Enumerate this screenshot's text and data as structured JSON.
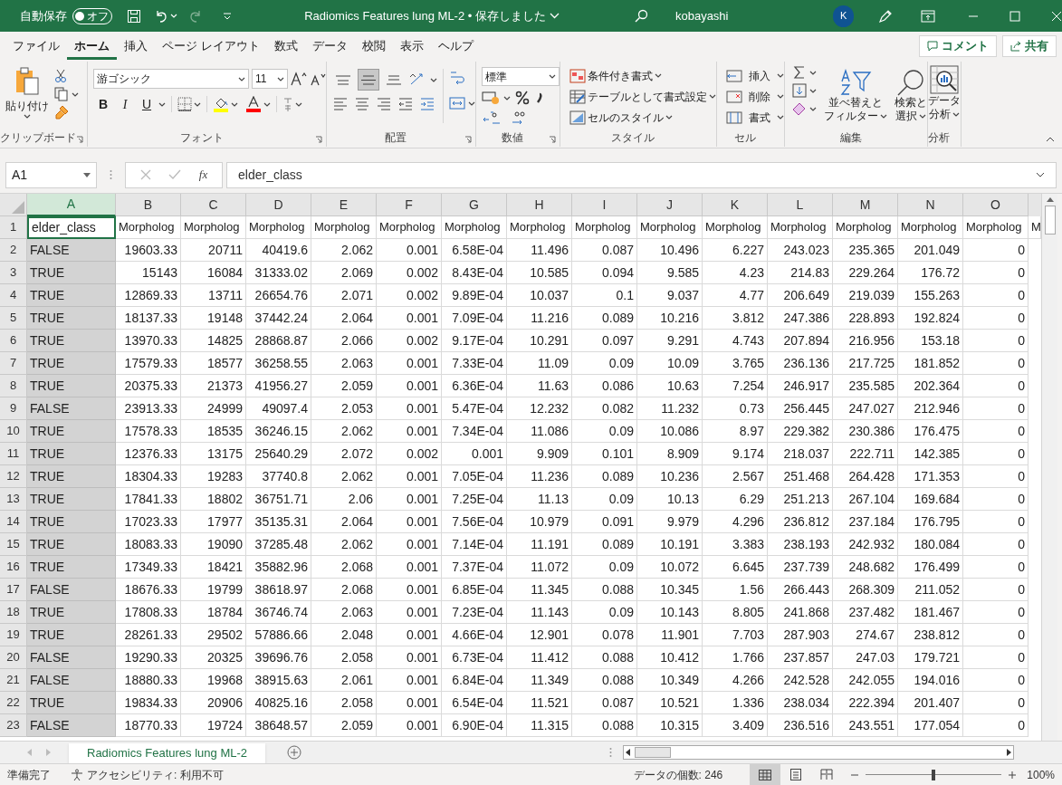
{
  "title_bar": {
    "autosave_label": "自動保存",
    "autosave_toggle": {
      "text": "オフ",
      "on": false
    },
    "redo": {
      "disabled": true
    },
    "title": "Radiomics Features lung ML-2 • 保存しました",
    "user": "kobayashi",
    "avatar": "K"
  },
  "ribbon_tabs": [
    {
      "label": "ファイル",
      "selected": false
    },
    {
      "label": "ホーム",
      "selected": true
    },
    {
      "label": "挿入",
      "selected": false
    },
    {
      "label": "ページ レイアウト",
      "selected": false
    },
    {
      "label": "数式",
      "selected": false
    },
    {
      "label": "データ",
      "selected": false
    },
    {
      "label": "校閲",
      "selected": false
    },
    {
      "label": "表示",
      "selected": false
    },
    {
      "label": "ヘルプ",
      "selected": false
    }
  ],
  "ribbon_actions": {
    "comment": "コメント",
    "share": "共有"
  },
  "clipboard": {
    "paste": "貼り付け",
    "label": "クリップボード"
  },
  "font": {
    "name": "游ゴシック",
    "size": "11",
    "bold": "B",
    "italic": "I",
    "underline": "U",
    "label": "フォント"
  },
  "alignment": {
    "vertical": [
      {
        "kind": "top",
        "selected": false
      },
      {
        "kind": "middle",
        "selected": true
      },
      {
        "kind": "bottom",
        "selected": false
      }
    ],
    "label": "配置"
  },
  "number": {
    "format": "標準",
    "label": "数値"
  },
  "styles": {
    "items": [
      "条件付き書式",
      "テーブルとして書式設定",
      "セルのスタイル"
    ],
    "label": "スタイル"
  },
  "cells": {
    "items": [
      "挿入",
      "削除",
      "書式"
    ],
    "label": "セル"
  },
  "editing": {
    "sort": [
      "並べ替えと",
      "フィルター"
    ],
    "find": [
      "検索と",
      "選択"
    ],
    "label": "編集"
  },
  "analysis": {
    "button": [
      "データ",
      "分析"
    ],
    "label": "分析"
  },
  "formula_bar": {
    "name_box": "A1",
    "function_label": "fx",
    "formula": "elder_class"
  },
  "columns": [
    {
      "letter": "A",
      "selected": true
    },
    {
      "letter": "B",
      "selected": false
    },
    {
      "letter": "C",
      "selected": false
    },
    {
      "letter": "D",
      "selected": false
    },
    {
      "letter": "E",
      "selected": false
    },
    {
      "letter": "F",
      "selected": false
    },
    {
      "letter": "G",
      "selected": false
    },
    {
      "letter": "H",
      "selected": false
    },
    {
      "letter": "I",
      "selected": false
    },
    {
      "letter": "J",
      "selected": false
    },
    {
      "letter": "K",
      "selected": false
    },
    {
      "letter": "L",
      "selected": false
    },
    {
      "letter": "M",
      "selected": false
    },
    {
      "letter": "N",
      "selected": false
    },
    {
      "letter": "O",
      "selected": false
    }
  ],
  "rows": [
    {
      "number": "1",
      "cells": [
        "elder_class",
        "Morpholog",
        "Morpholog",
        "Morpholog",
        "Morpholog",
        "Morpholog",
        "Morpholog",
        "Morpholog",
        "Morpholog",
        "Morpholog",
        "Morpholog",
        "Morpholog",
        "Morpholog",
        "Morpholog",
        "Morpholog",
        "M"
      ]
    },
    {
      "number": "2",
      "cells": [
        "FALSE",
        "19603.33",
        "20711",
        "40419.6",
        "2.062",
        "0.001",
        "6.58E-04",
        "11.496",
        "0.087",
        "10.496",
        "6.227",
        "243.023",
        "235.365",
        "201.049",
        "0"
      ]
    },
    {
      "number": "3",
      "cells": [
        "TRUE",
        "15143",
        "16084",
        "31333.02",
        "2.069",
        "0.002",
        "8.43E-04",
        "10.585",
        "0.094",
        "9.585",
        "4.23",
        "214.83",
        "229.264",
        "176.72",
        "0"
      ]
    },
    {
      "number": "4",
      "cells": [
        "TRUE",
        "12869.33",
        "13711",
        "26654.76",
        "2.071",
        "0.002",
        "9.89E-04",
        "10.037",
        "0.1",
        "9.037",
        "4.77",
        "206.649",
        "219.039",
        "155.263",
        "0"
      ]
    },
    {
      "number": "5",
      "cells": [
        "TRUE",
        "18137.33",
        "19148",
        "37442.24",
        "2.064",
        "0.001",
        "7.09E-04",
        "11.216",
        "0.089",
        "10.216",
        "3.812",
        "247.386",
        "228.893",
        "192.824",
        "0"
      ]
    },
    {
      "number": "6",
      "cells": [
        "TRUE",
        "13970.33",
        "14825",
        "28868.87",
        "2.066",
        "0.002",
        "9.17E-04",
        "10.291",
        "0.097",
        "9.291",
        "4.743",
        "207.894",
        "216.956",
        "153.18",
        "0"
      ]
    },
    {
      "number": "7",
      "cells": [
        "TRUE",
        "17579.33",
        "18577",
        "36258.55",
        "2.063",
        "0.001",
        "7.33E-04",
        "11.09",
        "0.09",
        "10.09",
        "3.765",
        "236.136",
        "217.725",
        "181.852",
        "0"
      ]
    },
    {
      "number": "8",
      "cells": [
        "TRUE",
        "20375.33",
        "21373",
        "41956.27",
        "2.059",
        "0.001",
        "6.36E-04",
        "11.63",
        "0.086",
        "10.63",
        "7.254",
        "246.917",
        "235.585",
        "202.364",
        "0"
      ]
    },
    {
      "number": "9",
      "cells": [
        "FALSE",
        "23913.33",
        "24999",
        "49097.4",
        "2.053",
        "0.001",
        "5.47E-04",
        "12.232",
        "0.082",
        "11.232",
        "0.73",
        "256.445",
        "247.027",
        "212.946",
        "0"
      ]
    },
    {
      "number": "10",
      "cells": [
        "TRUE",
        "17578.33",
        "18535",
        "36246.15",
        "2.062",
        "0.001",
        "7.34E-04",
        "11.086",
        "0.09",
        "10.086",
        "8.97",
        "229.382",
        "230.386",
        "176.475",
        "0"
      ]
    },
    {
      "number": "11",
      "cells": [
        "TRUE",
        "12376.33",
        "13175",
        "25640.29",
        "2.072",
        "0.002",
        "0.001",
        "9.909",
        "0.101",
        "8.909",
        "9.174",
        "218.037",
        "222.711",
        "142.385",
        "0"
      ]
    },
    {
      "number": "12",
      "cells": [
        "TRUE",
        "18304.33",
        "19283",
        "37740.8",
        "2.062",
        "0.001",
        "7.05E-04",
        "11.236",
        "0.089",
        "10.236",
        "2.567",
        "251.468",
        "264.428",
        "171.353",
        "0"
      ]
    },
    {
      "number": "13",
      "cells": [
        "TRUE",
        "17841.33",
        "18802",
        "36751.71",
        "2.06",
        "0.001",
        "7.25E-04",
        "11.13",
        "0.09",
        "10.13",
        "6.29",
        "251.213",
        "267.104",
        "169.684",
        "0"
      ]
    },
    {
      "number": "14",
      "cells": [
        "TRUE",
        "17023.33",
        "17977",
        "35135.31",
        "2.064",
        "0.001",
        "7.56E-04",
        "10.979",
        "0.091",
        "9.979",
        "4.296",
        "236.812",
        "237.184",
        "176.795",
        "0"
      ]
    },
    {
      "number": "15",
      "cells": [
        "TRUE",
        "18083.33",
        "19090",
        "37285.48",
        "2.062",
        "0.001",
        "7.14E-04",
        "11.191",
        "0.089",
        "10.191",
        "3.383",
        "238.193",
        "242.932",
        "180.084",
        "0"
      ]
    },
    {
      "number": "16",
      "cells": [
        "TRUE",
        "17349.33",
        "18421",
        "35882.96",
        "2.068",
        "0.001",
        "7.37E-04",
        "11.072",
        "0.09",
        "10.072",
        "6.645",
        "237.739",
        "248.682",
        "176.499",
        "0"
      ]
    },
    {
      "number": "17",
      "cells": [
        "FALSE",
        "18676.33",
        "19799",
        "38618.97",
        "2.068",
        "0.001",
        "6.85E-04",
        "11.345",
        "0.088",
        "10.345",
        "1.56",
        "266.443",
        "268.309",
        "211.052",
        "0"
      ]
    },
    {
      "number": "18",
      "cells": [
        "TRUE",
        "17808.33",
        "18784",
        "36746.74",
        "2.063",
        "0.001",
        "7.23E-04",
        "11.143",
        "0.09",
        "10.143",
        "8.805",
        "241.868",
        "237.482",
        "181.467",
        "0"
      ]
    },
    {
      "number": "19",
      "cells": [
        "TRUE",
        "28261.33",
        "29502",
        "57886.66",
        "2.048",
        "0.001",
        "4.66E-04",
        "12.901",
        "0.078",
        "11.901",
        "7.703",
        "287.903",
        "274.67",
        "238.812",
        "0"
      ]
    },
    {
      "number": "20",
      "cells": [
        "FALSE",
        "19290.33",
        "20325",
        "39696.76",
        "2.058",
        "0.001",
        "6.73E-04",
        "11.412",
        "0.088",
        "10.412",
        "1.766",
        "237.857",
        "247.03",
        "179.721",
        "0"
      ]
    },
    {
      "number": "21",
      "cells": [
        "FALSE",
        "18880.33",
        "19968",
        "38915.63",
        "2.061",
        "0.001",
        "6.84E-04",
        "11.349",
        "0.088",
        "10.349",
        "4.266",
        "242.528",
        "242.055",
        "194.016",
        "0"
      ]
    },
    {
      "number": "22",
      "cells": [
        "TRUE",
        "19834.33",
        "20906",
        "40825.16",
        "2.058",
        "0.001",
        "6.54E-04",
        "11.521",
        "0.087",
        "10.521",
        "1.336",
        "238.034",
        "222.394",
        "201.407",
        "0"
      ]
    },
    {
      "number": "23",
      "cells": [
        "FALSE",
        "18770.33",
        "19724",
        "38648.57",
        "2.059",
        "0.001",
        "6.90E-04",
        "11.315",
        "0.088",
        "10.315",
        "3.409",
        "236.516",
        "243.551",
        "177.054",
        "0"
      ]
    }
  ],
  "sheet_tabs": [
    {
      "label": "Radiomics Features lung ML-2",
      "selected": true
    }
  ],
  "status_bar": {
    "ready": "準備完了",
    "accessibility": "アクセシビリティ: 利用不可",
    "count": "データの個数: 246",
    "zoom": {
      "level": 0.5,
      "reading": "100%"
    }
  }
}
